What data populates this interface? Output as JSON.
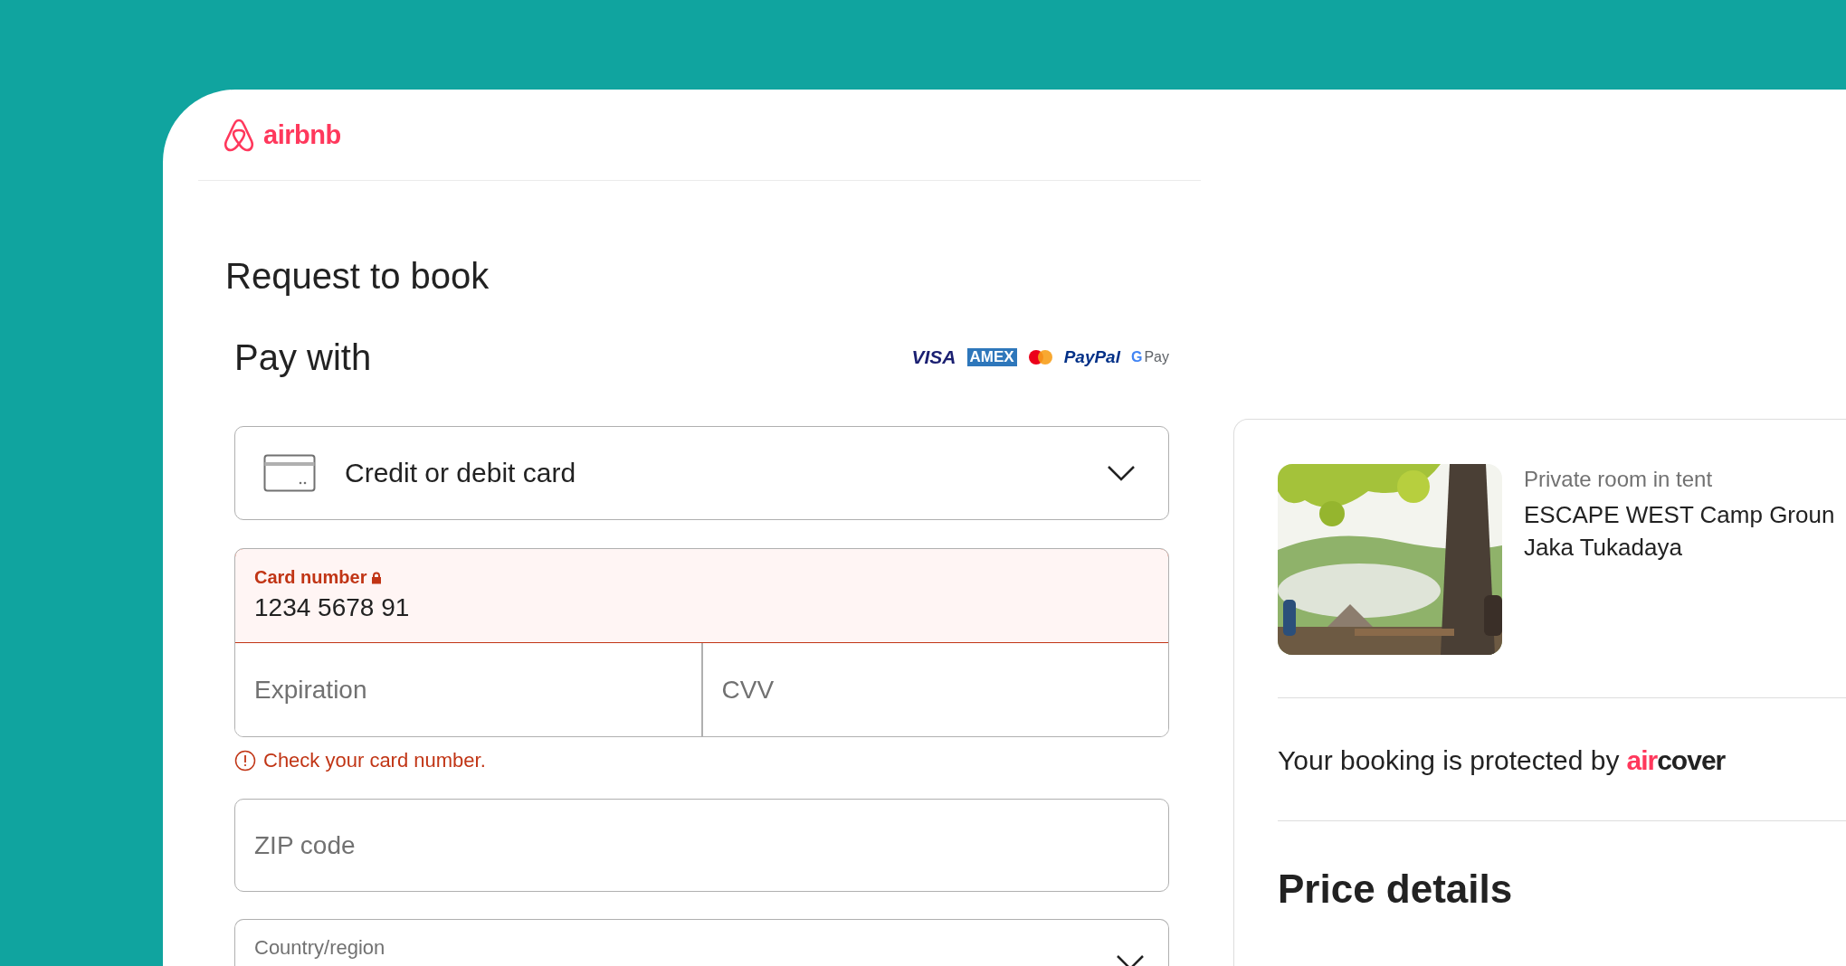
{
  "header": {
    "logo_text": "airbnb"
  },
  "title": "Request to book",
  "payment": {
    "heading": "Pay with",
    "methods": [
      {
        "kind": "visa",
        "label": "VISA"
      },
      {
        "kind": "amex",
        "label": "AMEX"
      },
      {
        "kind": "mastercard"
      },
      {
        "kind": "paypal",
        "label": "PayPal"
      },
      {
        "kind": "gpay",
        "mark": "G",
        "label": "Pay"
      }
    ],
    "method_select": {
      "value": "Credit or debit card"
    },
    "card_number": {
      "label": "Card number",
      "value": "1234 5678 91",
      "error": true
    },
    "expiration": {
      "placeholder": "Expiration"
    },
    "cvv": {
      "placeholder": "CVV"
    },
    "error_message": "Check your card number.",
    "zip": {
      "placeholder": "ZIP code"
    },
    "country": {
      "label": "Country/region"
    }
  },
  "listing": {
    "type": "Private room in tent",
    "title_lines": [
      "ESCAPE WEST Camp Groun",
      "Jaka Tukadaya"
    ]
  },
  "protection": {
    "text": "Your booking is protected by",
    "brand_accent": "air",
    "brand_rest": "cover"
  },
  "price_details": {
    "heading": "Price details"
  }
}
